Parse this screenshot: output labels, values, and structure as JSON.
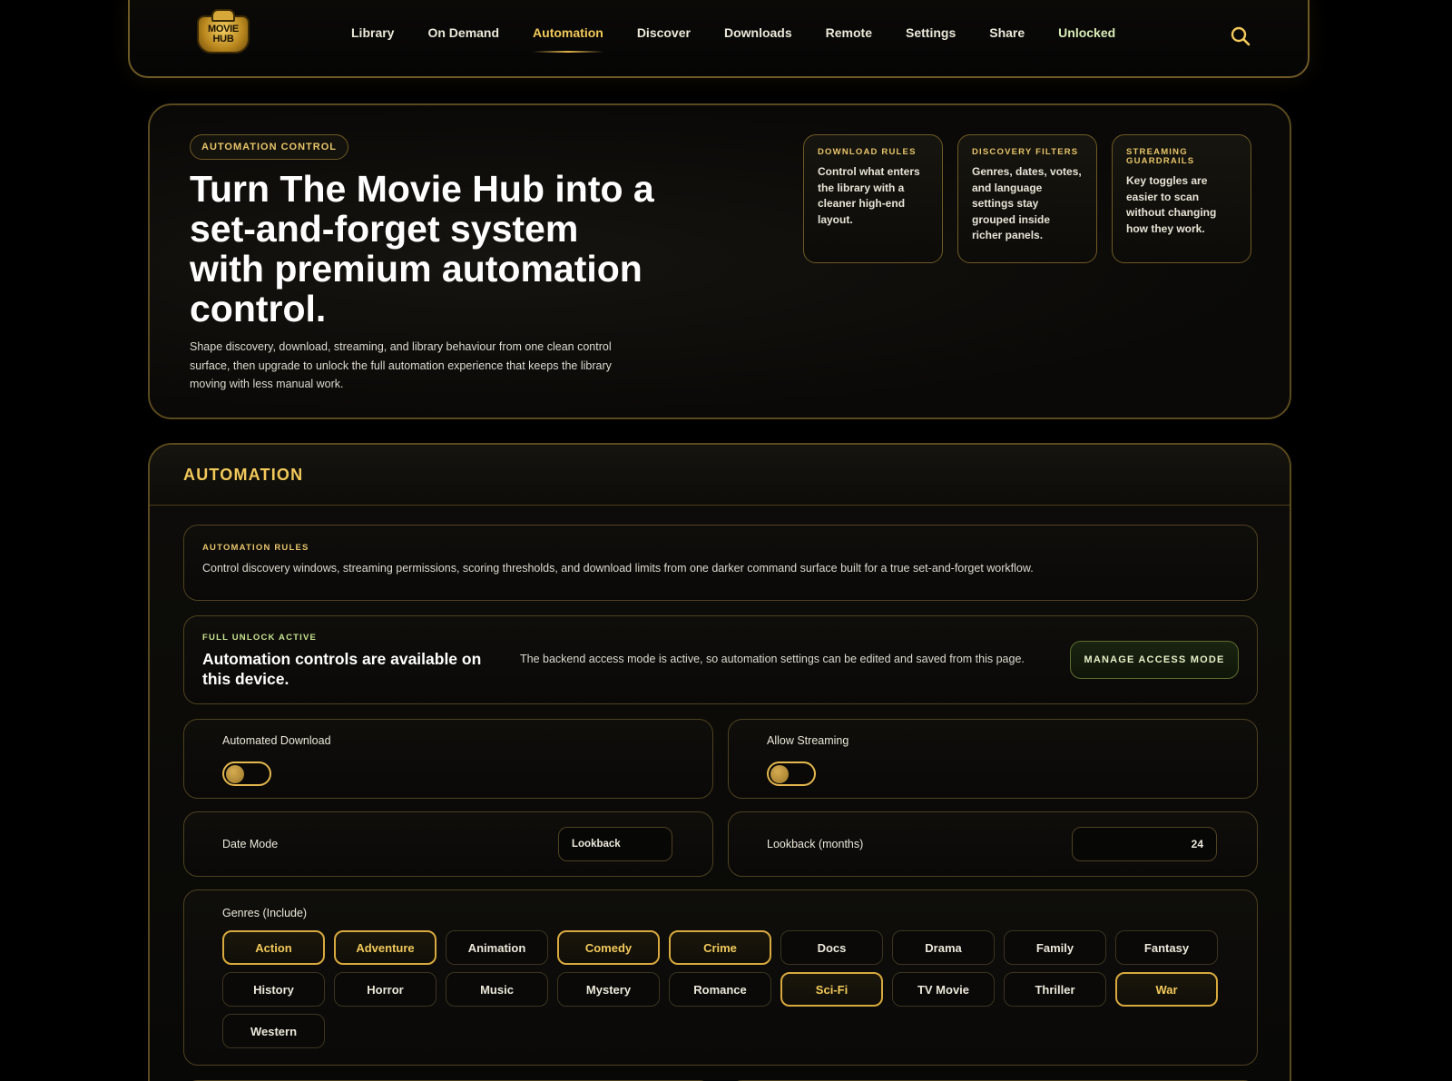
{
  "app": {
    "logo_text": "MOVIE HUB"
  },
  "nav": {
    "items": [
      {
        "label": "Library"
      },
      {
        "label": "On Demand"
      },
      {
        "label": "Automation"
      },
      {
        "label": "Discover"
      },
      {
        "label": "Downloads"
      },
      {
        "label": "Remote"
      },
      {
        "label": "Settings"
      },
      {
        "label": "Share"
      },
      {
        "label": "Unlocked"
      }
    ],
    "active": "Automation",
    "search_icon": "search-icon"
  },
  "hero": {
    "pill": "AUTOMATION CONTROL",
    "title": "Turn The Movie Hub into a set-and-forget system with premium automation control.",
    "description": "Shape discovery, download, streaming, and library behaviour from one clean control surface, then upgrade to unlock the full automation experience that keeps the library moving with less manual work.",
    "cards": [
      {
        "title": "DOWNLOAD RULES",
        "body": "Control what enters the library with a cleaner high-end layout."
      },
      {
        "title": "DISCOVERY FILTERS",
        "body": "Genres, dates, votes, and language settings stay grouped inside richer panels."
      },
      {
        "title": "STREAMING GUARDRAILS",
        "body": "Key toggles are easier to scan without changing how they work."
      }
    ]
  },
  "automation": {
    "title": "AUTOMATION",
    "rules": {
      "caption": "AUTOMATION RULES",
      "text": "Control discovery windows, streaming permissions, scoring thresholds, and download limits from one darker command surface built for a true set-and-forget workflow."
    },
    "unlock": {
      "caption": "FULL UNLOCK ACTIVE",
      "heading": "Automation controls are available on this device.",
      "description": "The backend access mode is active, so automation settings can be edited and saved from this page.",
      "button": "MANAGE ACCESS MODE"
    },
    "automated_download": {
      "label": "Automated Download",
      "enabled": false
    },
    "allow_streaming": {
      "label": "Allow Streaming",
      "enabled": false
    },
    "date_mode": {
      "label": "Date Mode",
      "value": "Lookback"
    },
    "lookback": {
      "label": "Lookback (months)",
      "value": "24"
    },
    "genres": {
      "label": "Genres (Include)",
      "items": [
        {
          "label": "Action",
          "selected": true
        },
        {
          "label": "Adventure",
          "selected": true
        },
        {
          "label": "Animation",
          "selected": false
        },
        {
          "label": "Comedy",
          "selected": true
        },
        {
          "label": "Crime",
          "selected": true
        },
        {
          "label": "Docs",
          "selected": false
        },
        {
          "label": "Drama",
          "selected": false
        },
        {
          "label": "Family",
          "selected": false
        },
        {
          "label": "Fantasy",
          "selected": false
        },
        {
          "label": "History",
          "selected": false
        },
        {
          "label": "Horror",
          "selected": false
        },
        {
          "label": "Music",
          "selected": false
        },
        {
          "label": "Mystery",
          "selected": false
        },
        {
          "label": "Romance",
          "selected": false
        },
        {
          "label": "Sci-Fi",
          "selected": true
        },
        {
          "label": "TV Movie",
          "selected": false
        },
        {
          "label": "Thriller",
          "selected": false
        },
        {
          "label": "War",
          "selected": true
        },
        {
          "label": "Western",
          "selected": false
        }
      ]
    }
  },
  "colors": {
    "accent_gold": "#f2c95a",
    "border_gold": "#6e5a26",
    "unlock_green": "#c9e38f"
  }
}
